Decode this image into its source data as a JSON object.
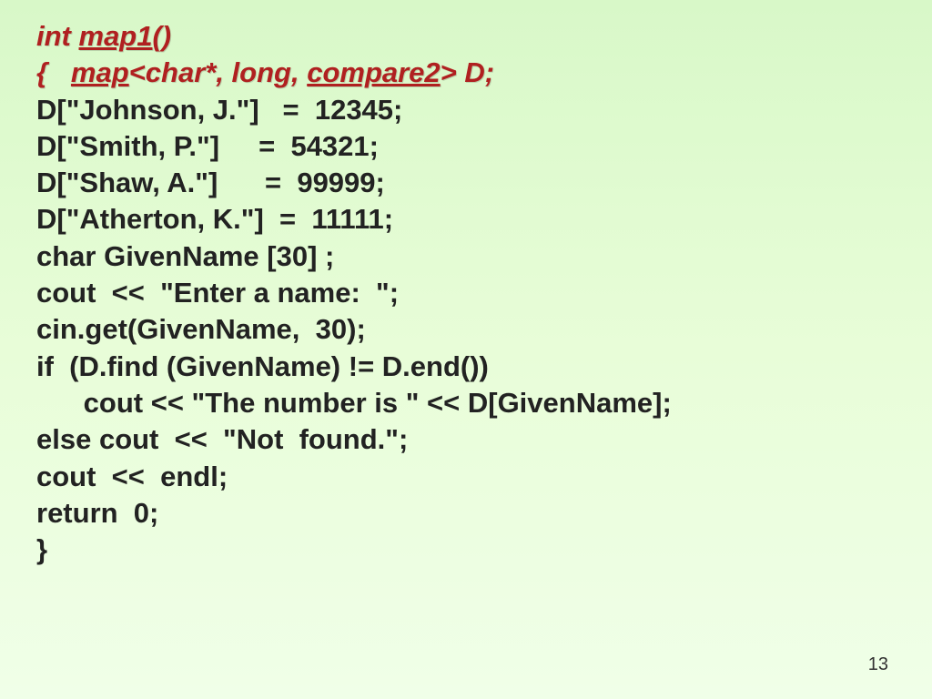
{
  "code": {
    "l1a": "int",
    "l1b": " ",
    "l1c": "map1",
    "l1d": "()",
    "l2a": "{",
    "l2b": "   ",
    "l2c": "map",
    "l2d": "<",
    "l2e": "char*, long, ",
    "l2f": "compare2",
    "l2g": "> ",
    "l2h": "D;",
    "l3": "D[\"Johnson, J.\"]   =  12345;",
    "l4": "D[\"Smith, P.\"]     =  54321;",
    "l5": "D[\"Shaw, A.\"]      =  99999;",
    "l6": "D[\"Atherton, K.\"]  =  11111;",
    "l7": "char GivenName [30] ;",
    "l8": "cout  <<  \"Enter a name:  \";",
    "l9": "cin.get(GivenName,  30);",
    "l10": "if  (D.find (GivenName) != D.end())",
    "l11": "      cout << \"The number is \" << D[GivenName];",
    "l12": "else cout  <<  \"Not  found.\";",
    "l13": "cout  <<  endl;",
    "l14": "return  0;",
    "l15": "}"
  },
  "page_number": "13"
}
